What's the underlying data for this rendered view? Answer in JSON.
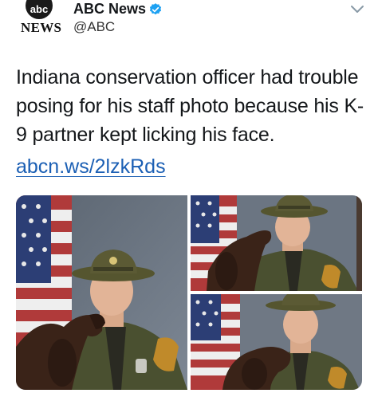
{
  "account": {
    "logo_text": "abc",
    "logo_sub": "NEWS",
    "display_name": "ABC News",
    "handle": "@ABC",
    "verified": true
  },
  "menu": {
    "icon": "chevron-down-icon"
  },
  "tweet": {
    "text": "Indiana conservation officer had trouble posing for his staff photo because his K-9 partner kept licking his face.",
    "link": "abcn.ws/2lzkRds"
  },
  "colors": {
    "link": "#1b5fb4",
    "verified": "#1da1f2",
    "uniform": "#4a5030",
    "hat": "#5b5a34",
    "dog": "#3a2318"
  }
}
